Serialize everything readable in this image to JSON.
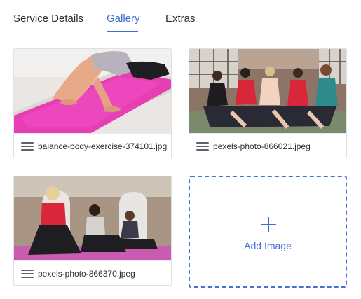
{
  "tabs": [
    {
      "label": "Service Details",
      "active": false
    },
    {
      "label": "Gallery",
      "active": true
    },
    {
      "label": "Extras",
      "active": false
    }
  ],
  "gallery": {
    "items": [
      {
        "filename": "balance-body-exercise-374101.jpg",
        "icon": "drag-handle-icon"
      },
      {
        "filename": "pexels-photo-866021.jpeg",
        "icon": "drag-handle-icon"
      },
      {
        "filename": "pexels-photo-866370.jpeg",
        "icon": "drag-handle-icon"
      }
    ],
    "add_label": "Add Image",
    "add_icon": "plus-icon"
  },
  "colors": {
    "accent": "#3b6fd6",
    "text": "#2b2f38",
    "border": "#dde1e8"
  }
}
